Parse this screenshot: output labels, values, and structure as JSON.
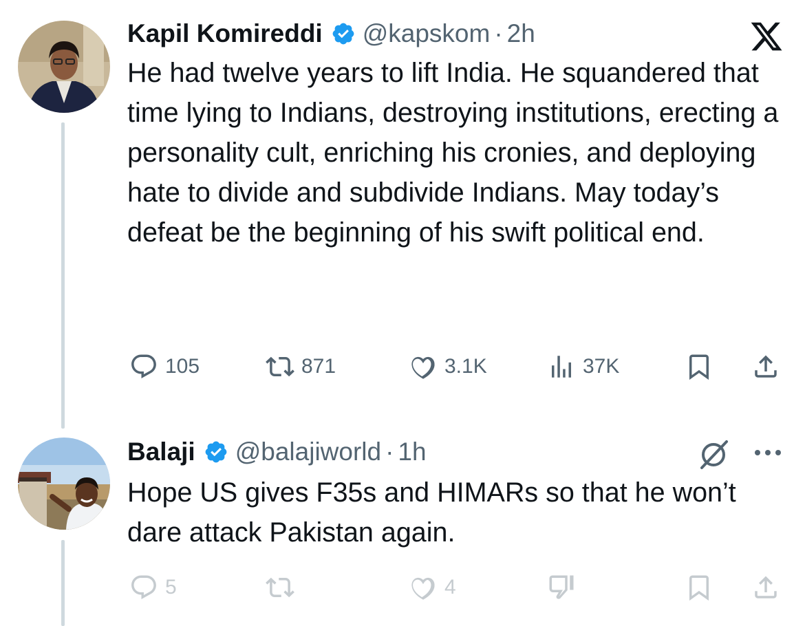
{
  "tweet1": {
    "name": "Kapil Komireddi",
    "handle": "@kapskom",
    "separator": "·",
    "time": "2h",
    "text": "He had twelve years to lift India. He squandered that time lying to Indians, destroying institutions, erecting a personality cult, enriching his cronies, and deploying hate to divide and subdivide Indians. May today’s defeat be the beginning of his swift political end.",
    "replies": "105",
    "reposts": "871",
    "likes": "3.1K",
    "views": "37K"
  },
  "tweet2": {
    "name": "Balaji",
    "handle": "@balajiworld",
    "separator": "·",
    "time": "1h",
    "text": "Hope US gives F35s and HIMARs so that he won’t dare attack Pakistan again.",
    "replies": "5",
    "likes": "4"
  },
  "icons": {
    "verified": "verified-badge-icon",
    "platform": "x-logo-icon",
    "grok": "grok-icon",
    "more": "more-icon"
  },
  "colors": {
    "verified": "#1d9bf0",
    "text": "#0f1419",
    "secondary": "#536471",
    "thread_line": "#cfd9de"
  }
}
